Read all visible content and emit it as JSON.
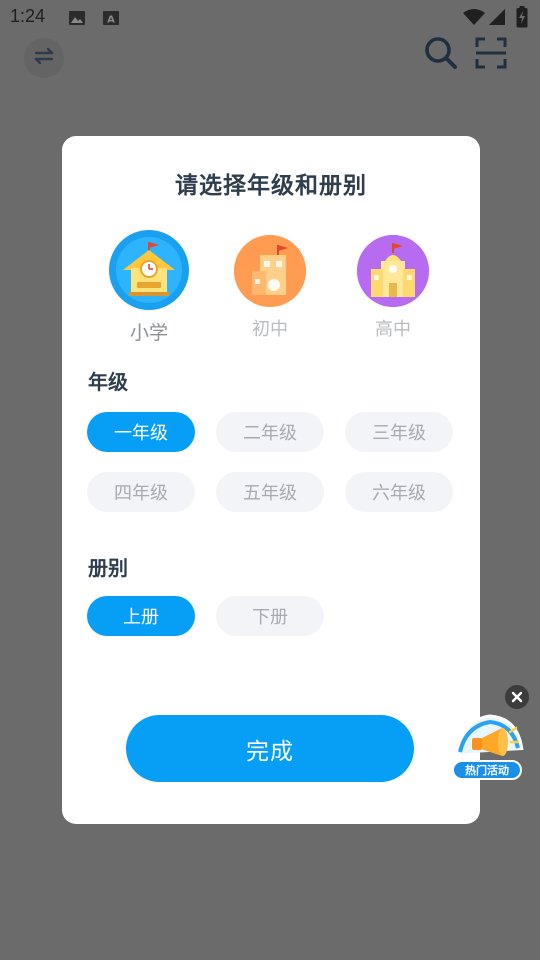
{
  "status_bar": {
    "time": "1:24",
    "icons_left": [
      "image-icon",
      "text-a-icon"
    ],
    "icons_right": [
      "wifi-icon",
      "signal-icon",
      "battery-charging-icon"
    ]
  },
  "toolbar": {
    "left_icon": "swap-icon",
    "right_icons": [
      "search-icon",
      "scan-icon"
    ]
  },
  "dialog": {
    "title": "请选择年级和册别",
    "levels": [
      {
        "label": "小学",
        "icon": "primary-school-icon",
        "color": "#1aa0f0",
        "selected": true
      },
      {
        "label": "初中",
        "icon": "middle-school-icon",
        "color": "#ff9c52",
        "selected": false
      },
      {
        "label": "高中",
        "icon": "high-school-icon",
        "color": "#b66bf0",
        "selected": false
      }
    ],
    "grade_section_title": "年级",
    "grades": [
      {
        "label": "一年级",
        "selected": true
      },
      {
        "label": "二年级",
        "selected": false
      },
      {
        "label": "三年级",
        "selected": false
      },
      {
        "label": "四年级",
        "selected": false
      },
      {
        "label": "五年级",
        "selected": false
      },
      {
        "label": "六年级",
        "selected": false
      }
    ],
    "volume_section_title": "册别",
    "volumes": [
      {
        "label": "上册",
        "selected": true
      },
      {
        "label": "下册",
        "selected": false
      }
    ],
    "done_label": "完成"
  },
  "promo": {
    "label": "热门活动",
    "icon": "megaphone-icon",
    "close_icon": "close-icon"
  },
  "colors": {
    "accent": "#079ef5",
    "overlay": "#6b6b6b",
    "title_text": "#2e3e4e",
    "pill_inactive_bg": "#f2f4f7",
    "pill_inactive_text": "#a7abb1"
  }
}
